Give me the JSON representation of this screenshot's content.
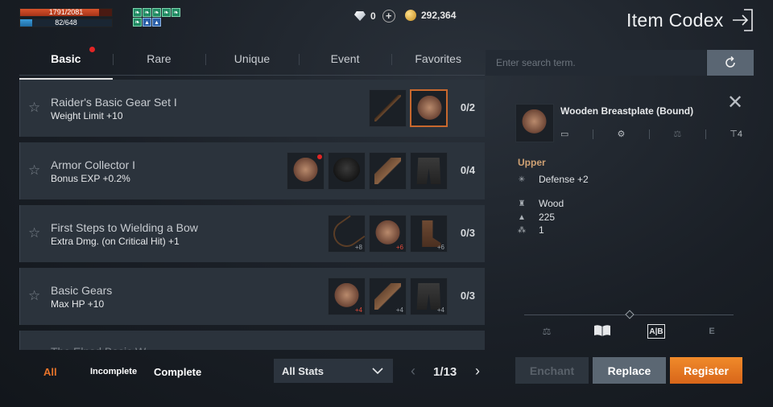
{
  "hud": {
    "hp_text": "1791/2081",
    "hp_fraction": 0.86,
    "mp_text": "82/648",
    "mp_fraction": 0.13,
    "buffs": [
      "leaf-icon",
      "leaf-icon",
      "leaf-icon",
      "leaf-icon",
      "leaf-icon",
      "leaf-icon",
      "boot-icon",
      "boot-icon"
    ],
    "gems": "0",
    "gold": "292,364"
  },
  "title": "Item Codex",
  "tabs": [
    {
      "label": "Basic",
      "active": true,
      "notify": true
    },
    {
      "label": "Rare"
    },
    {
      "label": "Unique"
    },
    {
      "label": "Event"
    },
    {
      "label": "Favorites"
    }
  ],
  "search": {
    "placeholder": "Enter search term."
  },
  "collections": [
    {
      "title": "Raider's Basic Gear Set I",
      "bonus": "Weight Limit +10",
      "count": "0/2",
      "items": [
        {
          "icon": "sword"
        },
        {
          "icon": "chest",
          "selected": true
        }
      ]
    },
    {
      "title": "Armor Collector I",
      "bonus": "Bonus EXP +0.2%",
      "count": "0/4",
      "items": [
        {
          "icon": "chest",
          "notify": true
        },
        {
          "icon": "helm"
        },
        {
          "icon": "glove"
        },
        {
          "icon": "pants"
        }
      ]
    },
    {
      "title": "First Steps to Wielding a Bow",
      "bonus": "Extra Dmg. (on Critical Hit) +1",
      "count": "0/3",
      "items": [
        {
          "icon": "bow",
          "enh": "+8"
        },
        {
          "icon": "chest",
          "enh": "+6",
          "enh_red": true
        },
        {
          "icon": "boots",
          "enh": "+6"
        }
      ]
    },
    {
      "title": "Basic Gears",
      "bonus": "Max HP +10",
      "count": "0/3",
      "items": [
        {
          "icon": "chest",
          "enh": "+4",
          "enh_red": true
        },
        {
          "icon": "glove",
          "enh": "+4"
        },
        {
          "icon": "pants",
          "enh": "+4"
        }
      ]
    }
  ],
  "partial_row": {
    "title": "The Elpsd Basic W..."
  },
  "filters": {
    "all": "All",
    "incomplete": "Incomplete",
    "complete": "Complete"
  },
  "filter_colors": {
    "active": "#e8742a",
    "inactive": "#ffffff"
  },
  "stats_dropdown": "All Stats",
  "pagination": "1/13",
  "detail": {
    "name": "Wooden Breastplate (Bound)",
    "attr_count": "4",
    "slot": "Upper",
    "defense": "Defense +2",
    "material": "Wood",
    "weight": "225",
    "quantity": "1"
  },
  "buttons": {
    "enchant": "Enchant",
    "replace": "Replace",
    "register": "Register"
  }
}
